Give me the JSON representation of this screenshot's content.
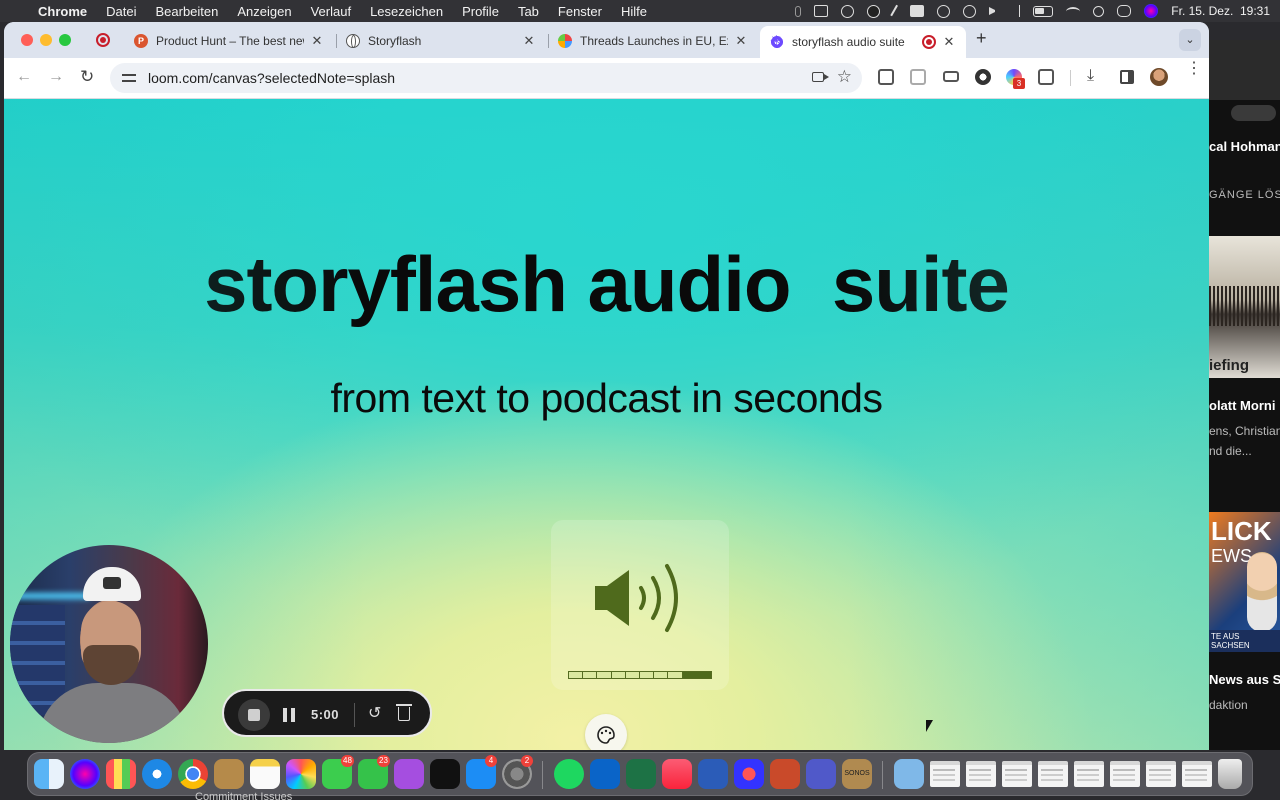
{
  "menubar": {
    "app": "Chrome",
    "items": [
      "Datei",
      "Bearbeiten",
      "Anzeigen",
      "Verlauf",
      "Lesezeichen",
      "Profile",
      "Tab",
      "Fenster",
      "Hilfe"
    ],
    "clock": "Fr. 15. Dez.  19:31"
  },
  "tabs": [
    {
      "title": "Product Hunt – The best new",
      "favicon": "product-hunt-icon"
    },
    {
      "title": "Storyflash",
      "favicon": "globe-icon"
    },
    {
      "title": "Threads Launches in EU, Exp",
      "favicon": "threads-icon"
    },
    {
      "title": "storyflash audio suite",
      "favicon": "storyflash-icon",
      "active": true
    }
  ],
  "toolbar": {
    "url": "loom.com/canvas?selectedNote=splash",
    "extension_badge": "3"
  },
  "page": {
    "title": "storyflash audio  suite",
    "subtitle": "from text to podcast in seconds",
    "audio_progress": 0.9,
    "audio_segments": 10,
    "accent_color": "#4f6a1c"
  },
  "recording": {
    "time": "5:00"
  },
  "background_window": {
    "name": "cal Hohmann",
    "section": "GÄNGE LÖSC",
    "image1_label": "iefing",
    "article1_title": "olatt Morni",
    "article1_line1": "ens, Christian",
    "article1_line2": "nd die...",
    "image2_line1": "LICK",
    "image2_line2": "EWS",
    "image2_caption": "TE AUS SACHSEN",
    "article2_title": "News aus S",
    "article2_line1": "daktion"
  },
  "dock": {
    "badges": {
      "messages": "48",
      "facetime": "23",
      "appstore": "4",
      "settings": "2"
    },
    "sonos_label": "SONOS"
  },
  "bottom_strip": "Commitment Issues"
}
